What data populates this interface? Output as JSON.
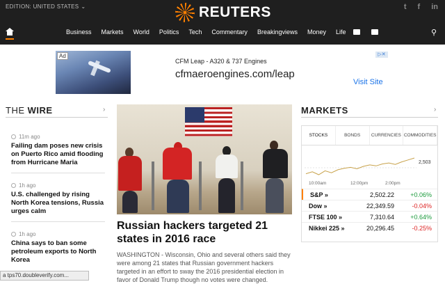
{
  "header": {
    "edition": "EDITION: UNITED STATES",
    "logo_text": "REUTERS",
    "social": [
      "twitter-icon",
      "facebook-icon",
      "linkedin-icon"
    ],
    "social_glyphs": [
      "t",
      "f",
      "in"
    ]
  },
  "nav": {
    "items": [
      "Business",
      "Markets",
      "World",
      "Politics",
      "Tech",
      "Commentary",
      "Breakingviews",
      "Money",
      "Life"
    ]
  },
  "ad": {
    "label": "Ad",
    "title": "CFM Leap - A320 & 737 Engines",
    "url": "cfmaeroengines.com/leap",
    "cta": "Visit Site"
  },
  "wire": {
    "title_light": "THE ",
    "title_bold": "WIRE",
    "items": [
      {
        "time": "11m ago",
        "title": "Failing dam poses new crisis on Puerto Rico amid flooding from Hurricane Maria"
      },
      {
        "time": "1h ago",
        "title": "U.S. challenged by rising North Korea tensions, Russia urges calm"
      },
      {
        "time": "1h ago",
        "title": "China says to ban some petroleum exports to North Korea"
      }
    ]
  },
  "lead": {
    "headline": "Russian hackers targeted 21 states in 2016 race",
    "body": "WASHINGTON - Wisconsin, Ohio and several others said they were among 21 states that Russian government hackers targeted in an effort to sway the 2016 presidential election in favor of Donald Trump though no votes were changed."
  },
  "markets": {
    "title": "MARKETS",
    "tabs": [
      "STOCKS",
      "BONDS",
      "CURRENCIES",
      "COMMODITIES"
    ],
    "chart": {
      "last_label": "2,503",
      "x_labels": [
        "10:00am",
        "12:00pm",
        "2:00pm"
      ]
    },
    "rows": [
      {
        "name": "S&P »",
        "value": "2,502.22",
        "change": "+0.06%",
        "dir": "up"
      },
      {
        "name": "Dow »",
        "value": "22,349.59",
        "change": "-0.04%",
        "dir": "down"
      },
      {
        "name": "FTSE 100 »",
        "value": "7,310.64",
        "change": "+0.64%",
        "dir": "up"
      },
      {
        "name": "Nikkei 225 »",
        "value": "20,296.45",
        "change": "-0.25%",
        "dir": "down"
      }
    ]
  },
  "status": {
    "text": "a tps70.doubleverify.com..."
  },
  "chart_data": {
    "type": "line",
    "x_labels": [
      "10:00am",
      "12:00pm",
      "2:00pm"
    ],
    "values": [
      2499.8,
      2500.2,
      2499.6,
      2500.4,
      2500.0,
      2500.6,
      2500.9,
      2501.1,
      2500.8,
      2501.3,
      2501.6,
      2501.4,
      2501.8,
      2502.0,
      2501.7,
      2502.2,
      2502.6,
      2503.0
    ],
    "last_label": "2,503"
  }
}
